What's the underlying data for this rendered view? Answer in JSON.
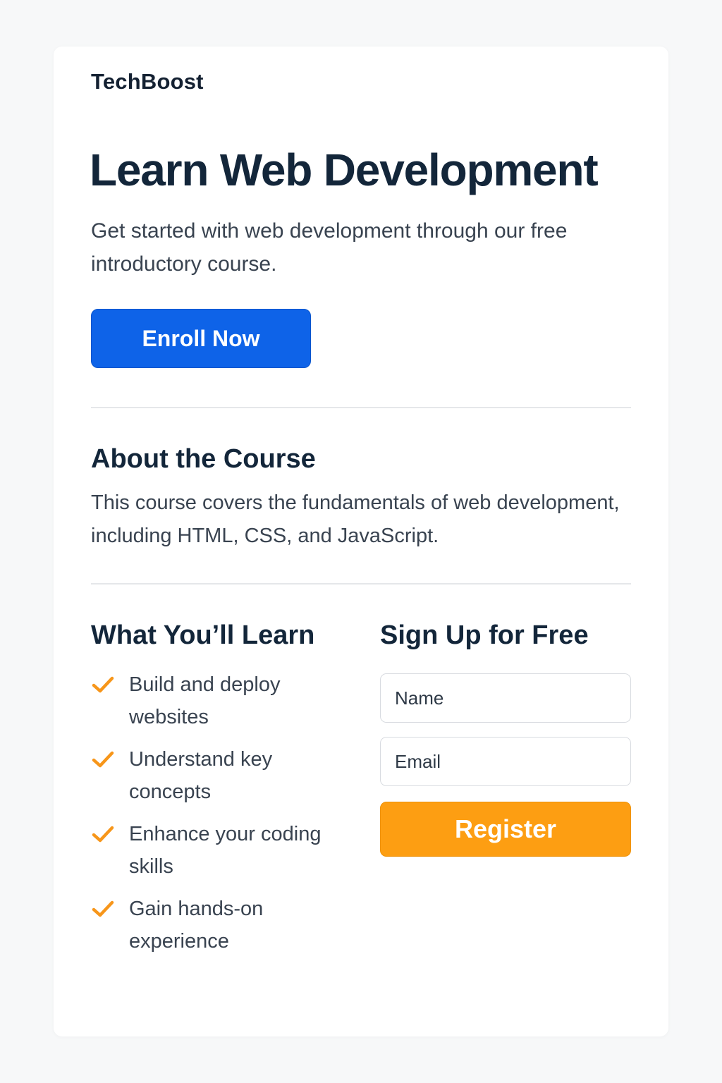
{
  "brand": {
    "name": "TechBoost"
  },
  "hero": {
    "title": "Learn Web Development",
    "subtitle": "Get started with web development through our free introductory course.",
    "cta_label": "Enroll Now"
  },
  "about": {
    "title": "About the Course",
    "text": "This course covers the fundamentals of web development, including HTML, CSS, and JavaScript."
  },
  "learn": {
    "title": "What You’ll Learn",
    "items": [
      {
        "label": "Build and deploy websites",
        "icon": "check-icon"
      },
      {
        "label": "Understand key concepts",
        "icon": "check-icon"
      },
      {
        "label": "Enhance your coding skills",
        "icon": "check-icon"
      },
      {
        "label": "Gain hands-on experience",
        "icon": "check-icon"
      }
    ]
  },
  "signup": {
    "title": "Sign Up for Free",
    "name_placeholder": "Name",
    "name_value": "",
    "email_placeholder": "Email",
    "email_value": "",
    "submit_label": "Register"
  },
  "colors": {
    "primary": "#0e63e8",
    "accent": "#fd9e12",
    "heading": "#13263a",
    "body_text": "#394350",
    "page_bg": "#f7f8f9",
    "card_bg": "#ffffff",
    "divider": "#e5e7ea"
  }
}
